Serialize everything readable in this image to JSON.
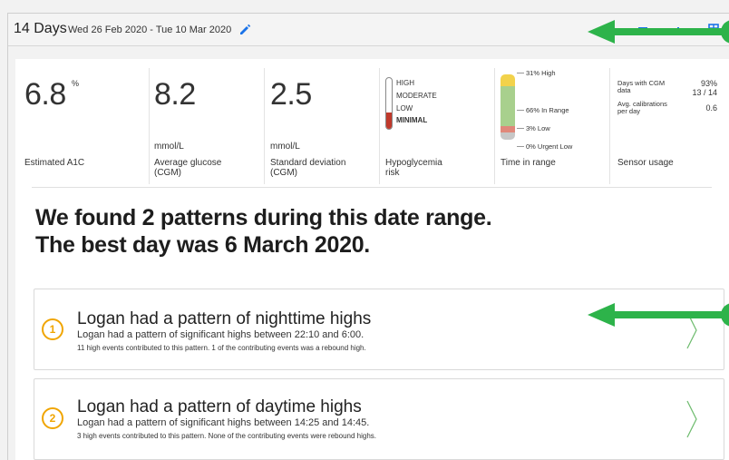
{
  "header": {
    "days": "14 Days",
    "date_range": "Wed 26 Feb 2020 - Tue 10 Mar 2020"
  },
  "stats": {
    "a1c": {
      "value": "6.8",
      "unit_sup": "%",
      "label": "Estimated A1C"
    },
    "glucose": {
      "value": "8.2",
      "unit": "mmol/L",
      "label_line1": "Average glucose",
      "label_line2": "(CGM)"
    },
    "sd": {
      "value": "2.5",
      "unit": "mmol/L",
      "label_line1": "Standard deviation",
      "label_line2": "(CGM)"
    },
    "hypo": {
      "levels": [
        "HIGH",
        "MODERATE",
        "LOW",
        "MINIMAL"
      ],
      "selected": "MINIMAL",
      "label_line1": "Hypoglycemia",
      "label_line2": "risk"
    },
    "tir": {
      "high": "31% High",
      "in_range": "66% In Range",
      "low": "3% Low",
      "urgent_low": "0% Urgent Low",
      "label": "Time in range",
      "colors": {
        "high": "#f2d24b",
        "in_range": "#a8d08d",
        "low": "#e0887a",
        "urgent_low": "#c7c7c7"
      },
      "fractions": {
        "high": 0.31,
        "in_range": 0.66,
        "low": 0.03,
        "urgent_low": 0.0
      }
    },
    "sensor": {
      "row1_label_a": "Days with CGM",
      "row1_label_b": "data",
      "row1_val_a": "93%",
      "row1_val_b": "13 / 14",
      "row2_label_a": "Avg. calibrations",
      "row2_label_b": "per day",
      "row2_val": "0.6",
      "label": "Sensor usage"
    }
  },
  "headline": {
    "line1": "We found 2 patterns during this date range.",
    "line2": "The best day was 6 March 2020."
  },
  "patterns": [
    {
      "number": "1",
      "title": "Logan had a pattern of nighttime highs",
      "description": "Logan had a pattern of significant highs between 22:10 and 6:00.",
      "note": "11 high events contributed to this pattern. 1 of the contributing events was a rebound high."
    },
    {
      "number": "2",
      "title": "Logan had a pattern of daytime highs",
      "description": "Logan had a pattern of significant highs between 14:25 and 14:45.",
      "note": "3 high events contributed to this pattern. None of the contributing events were rebound highs."
    }
  ],
  "colors": {
    "accent_blue": "#1a73e8",
    "pattern_orange": "#f0a500",
    "arrow_green": "#2db34a",
    "hypo_red": "#c0392b"
  },
  "icons": [
    "pencil-icon",
    "menu-icon",
    "chart-icon",
    "grid-icon",
    "chevron-right-icon",
    "arrow-left-icon"
  ]
}
